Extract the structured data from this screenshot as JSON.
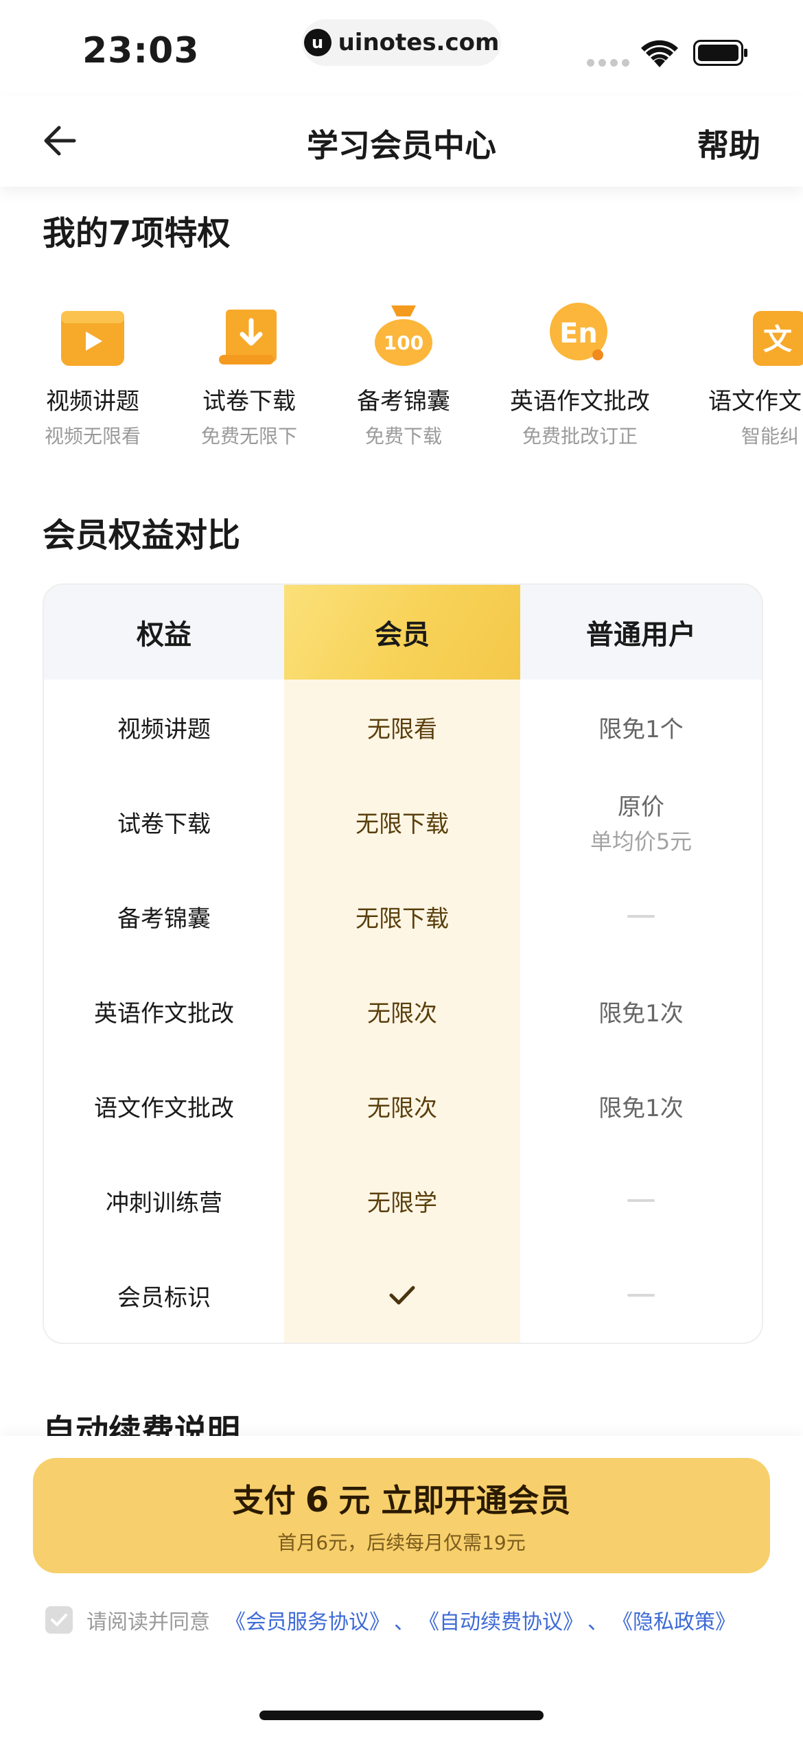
{
  "status_bar": {
    "time": "23:03",
    "url": "uinotes.com"
  },
  "nav": {
    "title": "学习会员中心",
    "help": "帮助"
  },
  "privileges": {
    "title": "我的7项特权",
    "items": [
      {
        "name": "视频讲题",
        "desc": "视频无限看",
        "icon": "video-play-icon"
      },
      {
        "name": "试卷下载",
        "desc": "免费无限下",
        "icon": "download-scroll-icon"
      },
      {
        "name": "备考锦囊",
        "desc": "免费下载",
        "icon": "money-bag-icon"
      },
      {
        "name": "英语作文批改",
        "desc": "免费批改订正",
        "icon": "english-bubble-icon"
      },
      {
        "name": "语文作文",
        "desc": "智能纠",
        "icon": "chinese-wen-icon"
      }
    ]
  },
  "comparison": {
    "title": "会员权益对比",
    "headers": [
      "权益",
      "会员",
      "普通用户"
    ],
    "rows": [
      {
        "benefit": "视频讲题",
        "vip": "无限看",
        "normal": "限免1个",
        "normal_sub": ""
      },
      {
        "benefit": "试卷下载",
        "vip": "无限下载",
        "normal": "原价",
        "normal_sub": "单均价5元"
      },
      {
        "benefit": "备考锦囊",
        "vip": "无限下载",
        "normal": "",
        "normal_sub": ""
      },
      {
        "benefit": "英语作文批改",
        "vip": "无限次",
        "normal": "限免1次",
        "normal_sub": ""
      },
      {
        "benefit": "语文作文批改",
        "vip": "无限次",
        "normal": "限免1次",
        "normal_sub": ""
      },
      {
        "benefit": "冲刺训练营",
        "vip": "无限学",
        "normal": "",
        "normal_sub": ""
      },
      {
        "benefit": "会员标识",
        "vip": "✓",
        "normal": "",
        "normal_sub": ""
      }
    ]
  },
  "renewal": {
    "title": "自动续费说明"
  },
  "pay": {
    "prefix": "支付",
    "amount": "6",
    "suffix": "元  立即开通会员",
    "sub": "首月6元，后续每月仅需19元"
  },
  "agreement": {
    "text": "请阅读并同意",
    "links": [
      "《会员服务协议》",
      "《自动续费协议》",
      "《隐私政策》"
    ],
    "separator": "、"
  },
  "colors": {
    "vip_col": "#fef6e5",
    "pay_button": "#f7cf6c",
    "link": "#3d6ad6",
    "icon_orange": "#f7a92a"
  }
}
